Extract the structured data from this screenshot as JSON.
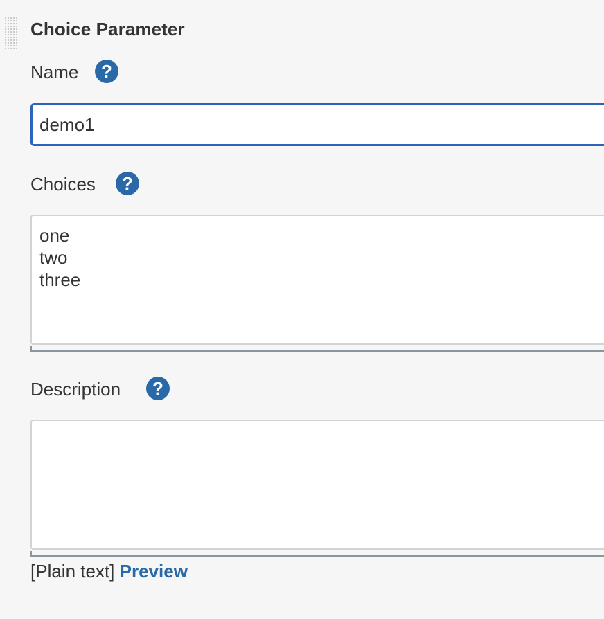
{
  "section": {
    "title": "Choice Parameter"
  },
  "fields": {
    "name": {
      "label": "Name",
      "value": "demo1",
      "help_icon": "question-circle-icon"
    },
    "choices": {
      "label": "Choices",
      "value": "one\ntwo\nthree",
      "help_icon": "question-circle-icon"
    },
    "description": {
      "label": "Description",
      "value": "",
      "help_icon": "question-circle-icon"
    }
  },
  "markup": {
    "format_label": "[Plain text]",
    "preview_label": "Preview"
  },
  "icons": {
    "help_glyph": "?"
  },
  "colors": {
    "accent": "#2a69a8",
    "focus_border": "#2b63bf",
    "background": "#f6f6f6"
  }
}
